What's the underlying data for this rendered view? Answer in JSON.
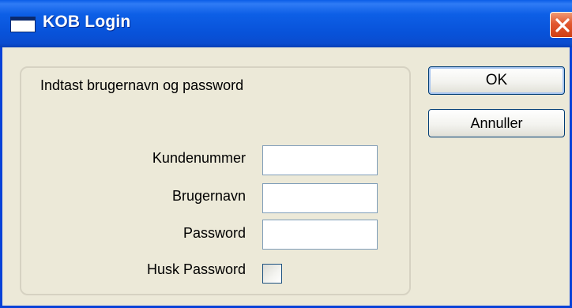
{
  "window": {
    "title": "KOB Login",
    "icon": "window-icon",
    "close_icon": "close-icon"
  },
  "form": {
    "instruction": "Indtast brugernavn og password",
    "fields": [
      {
        "label": "Kundenummer",
        "value": ""
      },
      {
        "label": "Brugernavn",
        "value": ""
      },
      {
        "label": "Password",
        "value": ""
      }
    ],
    "remember": {
      "label": "Husk Password",
      "checked": false
    }
  },
  "buttons": {
    "ok_label": "OK",
    "cancel_label": "Annuller"
  },
  "colors": {
    "titlebar": "#0852d9",
    "dialog_bg": "#ece9d8",
    "close_button": "#e2582f",
    "input_border": "#7f9db9"
  }
}
